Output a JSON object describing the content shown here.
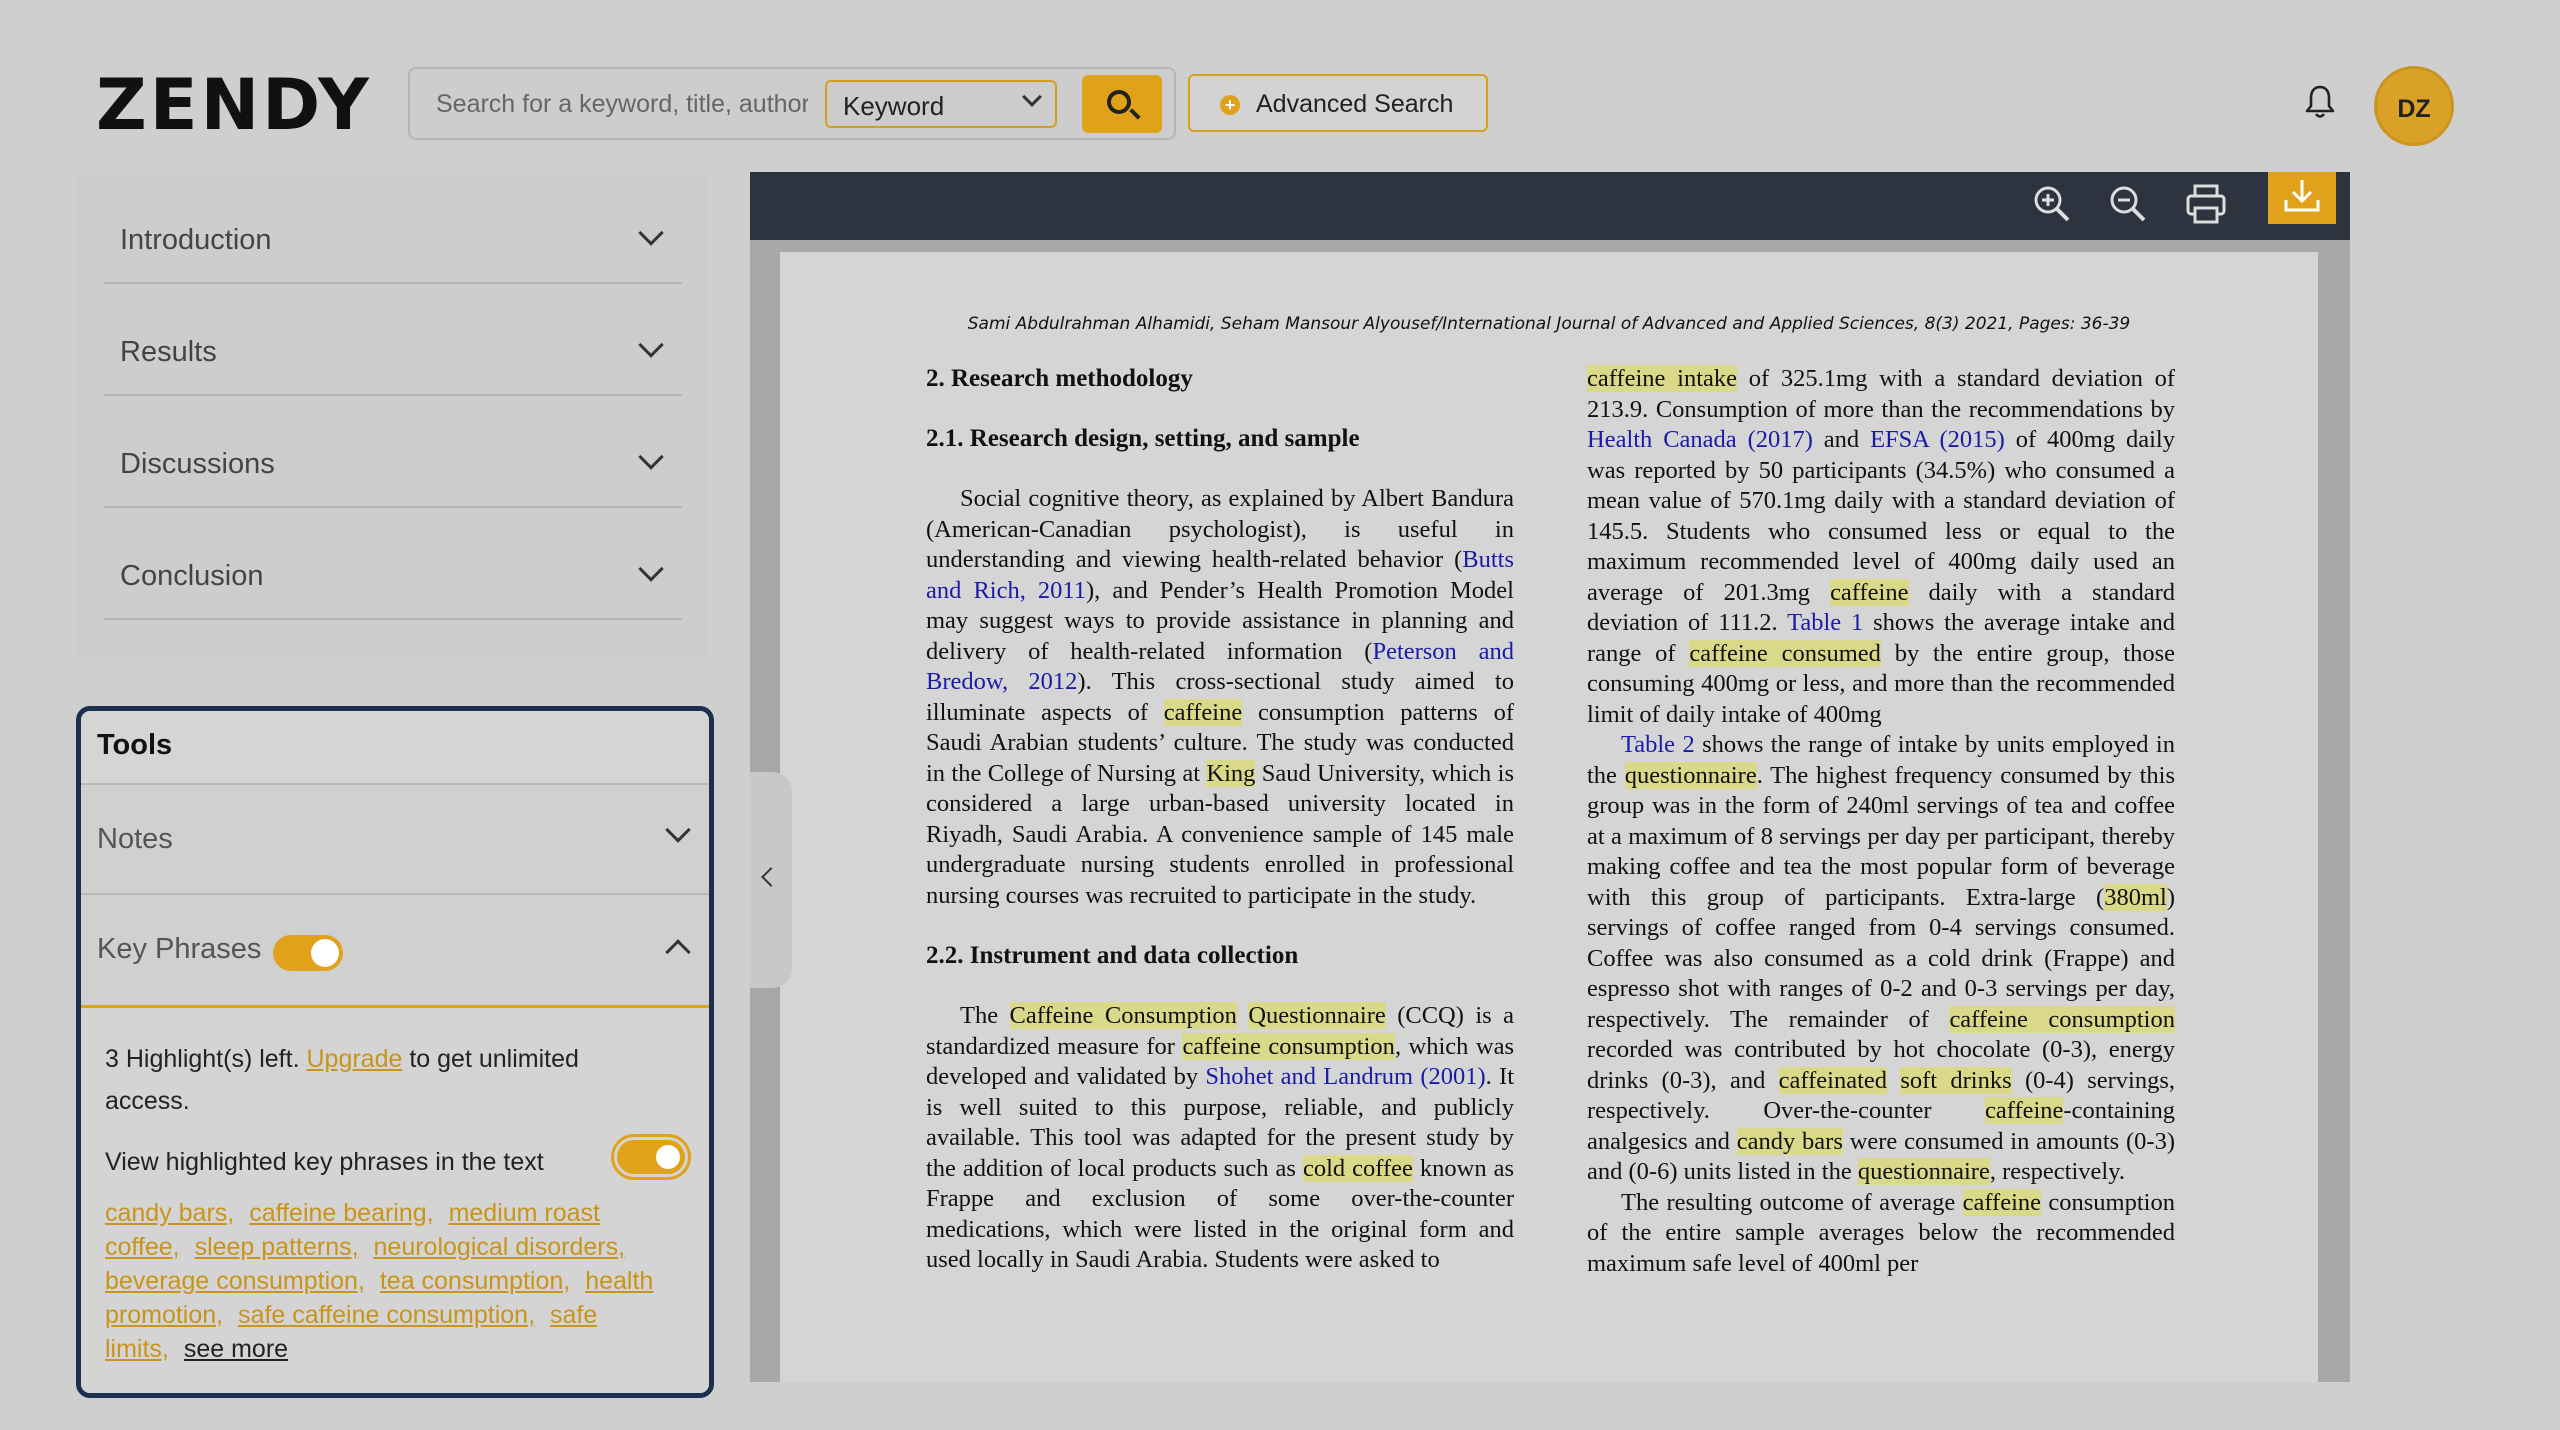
{
  "header": {
    "logo": "ZENDY",
    "search_placeholder": "Search for a keyword, title, author...",
    "search_type": "Keyword",
    "advanced_search": "Advanced Search",
    "avatar_initials": "DZ"
  },
  "outline": {
    "items": [
      {
        "label": "Introduction"
      },
      {
        "label": "Results"
      },
      {
        "label": "Discussions"
      },
      {
        "label": "Conclusion"
      }
    ]
  },
  "tools": {
    "title": "Tools",
    "notes_label": "Notes",
    "key_phrases_label": "Key Phrases",
    "highlights_left": "3 Highlight(s) left.",
    "upgrade_link": "Upgrade",
    "highlights_suffix": "to get unlimited access.",
    "view_highlighted": "View highlighted key phrases in the text",
    "phrases": [
      "candy bars,",
      "caffeine bearing,",
      "medium roast coffee,",
      "sleep patterns,",
      "neurological disorders,",
      "beverage consumption,",
      "tea consumption,",
      "health promotion,",
      "safe caffeine consumption,",
      "safe limits,"
    ],
    "see_more": "see more"
  },
  "document": {
    "running_header": "Sami Abdulrahman Alhamidi, Seham Mansour Alyousef/International Journal of Advanced and Applied Sciences, 8(3) 2021, Pages: 36-39",
    "h_methodology": "2. Research methodology",
    "h_design": "2.1. Research design, setting, and sample",
    "h_instrument": "2.2. Instrument and data collection"
  },
  "colors": {
    "accent": "#e0a21a",
    "toolbar": "#2e3340",
    "tools_border": "#1c2f4e",
    "highlight": "#dad98a",
    "link": "#1a1aa8"
  }
}
